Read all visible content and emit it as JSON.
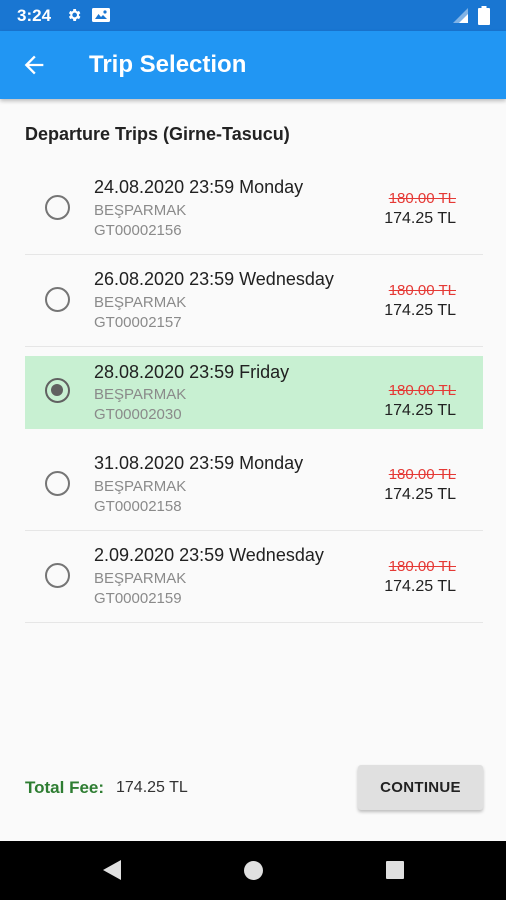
{
  "status": {
    "time": "3:24"
  },
  "header": {
    "title": "Trip Selection"
  },
  "section": {
    "title": "Departure Trips (Girne-Tasucu)"
  },
  "trips": [
    {
      "date": "24.08.2020 23:59 Monday",
      "company": "BEŞPARMAK",
      "code": "GT00002156",
      "old_price": "180.00 TL",
      "price": "174.25 TL",
      "selected": false
    },
    {
      "date": "26.08.2020 23:59 Wednesday",
      "company": "BEŞPARMAK",
      "code": "GT00002157",
      "old_price": "180.00 TL",
      "price": "174.25 TL",
      "selected": false
    },
    {
      "date": "28.08.2020 23:59 Friday",
      "company": "BEŞPARMAK",
      "code": "GT00002030",
      "old_price": "180.00 TL",
      "price": "174.25 TL",
      "selected": true
    },
    {
      "date": "31.08.2020 23:59 Monday",
      "company": "BEŞPARMAK",
      "code": "GT00002158",
      "old_price": "180.00 TL",
      "price": "174.25 TL",
      "selected": false
    },
    {
      "date": "2.09.2020 23:59 Wednesday",
      "company": "BEŞPARMAK",
      "code": "GT00002159",
      "old_price": "180.00 TL",
      "price": "174.25 TL",
      "selected": false
    }
  ],
  "footer": {
    "total_label": "Total Fee:",
    "total_value": "174.25 TL",
    "continue_label": "CONTINUE"
  },
  "colors": {
    "status_bar": "#1976d2",
    "app_bar": "#2196f3",
    "selected_row": "#c8f0d2",
    "old_price": "#e53935",
    "total_label": "#2e7d32"
  },
  "icons": {
    "status": [
      "gear-icon",
      "mail-icon",
      "signal-icon",
      "battery-icon"
    ],
    "header": "back-arrow-icon",
    "nav": [
      "nav-back-icon",
      "nav-home-icon",
      "nav-recents-icon"
    ]
  }
}
